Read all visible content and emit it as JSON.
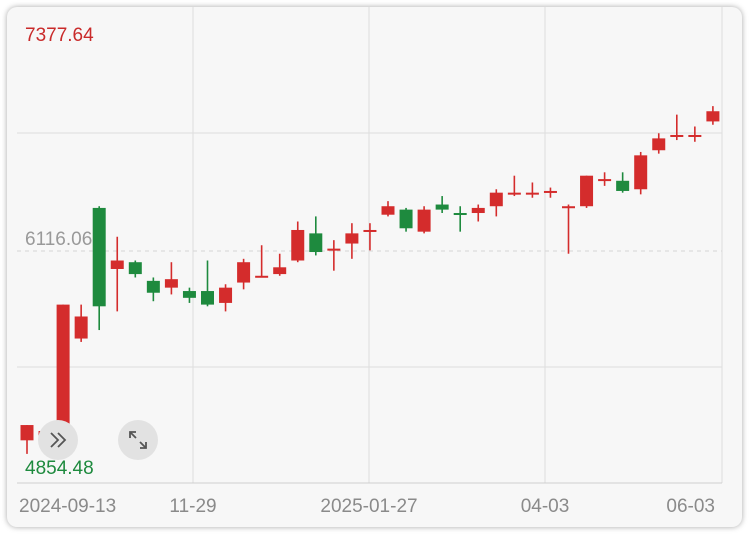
{
  "chart_data": {
    "type": "candlestick",
    "title": "",
    "price_max_label": "7377.64",
    "price_mid_label": "6116.06",
    "price_min_label": "4854.48",
    "ylim": [
      4854.48,
      7377.64
    ],
    "x_tick_labels": [
      "2024-09-13",
      "11-29",
      "2025-01-27",
      "04-03",
      "06-03"
    ],
    "colors": {
      "up": "#d42c2c",
      "down": "#1e8a3e",
      "grid": "#dddddd"
    },
    "candles": [
      {
        "o": 5000,
        "c": 5090,
        "h": 5090,
        "l": 4920
      },
      {
        "o": 5010,
        "c": 5055,
        "h": 5060,
        "l": 4990
      },
      {
        "o": 5025,
        "c": 5800,
        "h": 5800,
        "l": 5010
      },
      {
        "o": 5600,
        "c": 5730,
        "h": 5800,
        "l": 5580
      },
      {
        "o": 6370,
        "c": 5790,
        "h": 6380,
        "l": 5650
      },
      {
        "o": 6010,
        "c": 6060,
        "h": 6200,
        "l": 5760
      },
      {
        "o": 6050,
        "c": 5980,
        "h": 6060,
        "l": 5960
      },
      {
        "o": 5940,
        "c": 5870,
        "h": 5960,
        "l": 5820
      },
      {
        "o": 5900,
        "c": 5950,
        "h": 6050,
        "l": 5860
      },
      {
        "o": 5880,
        "c": 5840,
        "h": 5900,
        "l": 5810
      },
      {
        "o": 5880,
        "c": 5800,
        "h": 6060,
        "l": 5790
      },
      {
        "o": 5810,
        "c": 5900,
        "h": 5920,
        "l": 5760
      },
      {
        "o": 5930,
        "c": 6050,
        "h": 6070,
        "l": 5890
      },
      {
        "o": 5970,
        "c": 5970,
        "h": 6150,
        "l": 5960
      },
      {
        "o": 5980,
        "c": 6020,
        "h": 6100,
        "l": 5970
      },
      {
        "o": 6060,
        "c": 6240,
        "h": 6290,
        "l": 6050
      },
      {
        "o": 6220,
        "c": 6110,
        "h": 6320,
        "l": 6090
      },
      {
        "o": 6130,
        "c": 6130,
        "h": 6180,
        "l": 6000
      },
      {
        "o": 6160,
        "c": 6220,
        "h": 6280,
        "l": 6070
      },
      {
        "o": 6240,
        "c": 6240,
        "h": 6280,
        "l": 6120
      },
      {
        "o": 6330,
        "c": 6380,
        "h": 6410,
        "l": 6320
      },
      {
        "o": 6360,
        "c": 6250,
        "h": 6370,
        "l": 6230
      },
      {
        "o": 6230,
        "c": 6360,
        "h": 6380,
        "l": 6220
      },
      {
        "o": 6390,
        "c": 6360,
        "h": 6440,
        "l": 6340
      },
      {
        "o": 6340,
        "c": 6330,
        "h": 6380,
        "l": 6230
      },
      {
        "o": 6340,
        "c": 6370,
        "h": 6390,
        "l": 6290
      },
      {
        "o": 6380,
        "c": 6460,
        "h": 6480,
        "l": 6320
      },
      {
        "o": 6460,
        "c": 6460,
        "h": 6560,
        "l": 6440
      },
      {
        "o": 6460,
        "c": 6460,
        "h": 6520,
        "l": 6430
      },
      {
        "o": 6470,
        "c": 6470,
        "h": 6490,
        "l": 6430
      },
      {
        "o": 6380,
        "c": 6380,
        "h": 6390,
        "l": 6100
      },
      {
        "o": 6380,
        "c": 6560,
        "h": 6560,
        "l": 6370
      },
      {
        "o": 6540,
        "c": 6540,
        "h": 6580,
        "l": 6500
      },
      {
        "o": 6530,
        "c": 6470,
        "h": 6580,
        "l": 6460
      },
      {
        "o": 6480,
        "c": 6680,
        "h": 6700,
        "l": 6450
      },
      {
        "o": 6710,
        "c": 6780,
        "h": 6810,
        "l": 6690
      },
      {
        "o": 6800,
        "c": 6800,
        "h": 6920,
        "l": 6770
      },
      {
        "o": 6800,
        "c": 6800,
        "h": 6850,
        "l": 6760
      },
      {
        "o": 6880,
        "c": 6940,
        "h": 6970,
        "l": 6860
      }
    ]
  }
}
